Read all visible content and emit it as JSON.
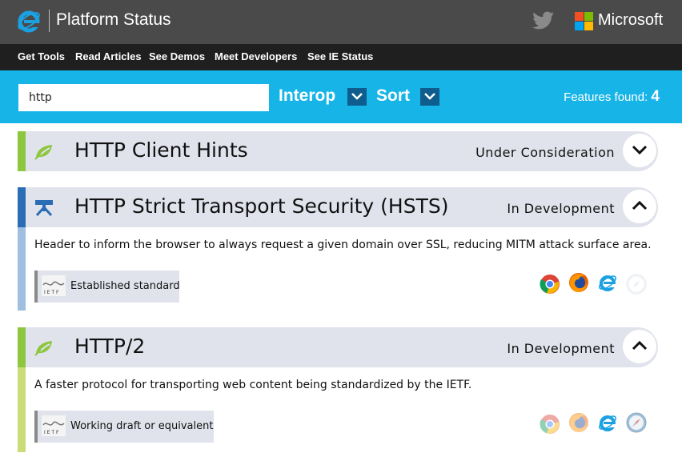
{
  "header": {
    "title": "Platform Status",
    "brand": "Microsoft",
    "colors": {
      "topbar": "#4a4a4a",
      "navbar": "#1f1f1f",
      "searchbar": "#17b4e8",
      "ie_blue": "#1ba1e2"
    }
  },
  "nav": {
    "items": [
      "Get Tools",
      "Read Articles",
      "See Demos",
      "Meet Developers",
      "See IE Status"
    ]
  },
  "search": {
    "value": "http",
    "filter1_label": "Interop",
    "filter2_label": "Sort",
    "features_found_label": "Features found:",
    "features_found_count": "4"
  },
  "features": [
    {
      "title": "HTTP Client Hints",
      "status": "Under Consideration",
      "expanded": false,
      "stripe_color": "#8dc63f",
      "icon": "leaf-icon"
    },
    {
      "title": "HTTP Strict Transport Security (HSTS)",
      "status": "In Development",
      "expanded": true,
      "stripe_color": "#2a6db5",
      "icon": "hammer-icon",
      "description": "Header to inform the browser to always request a given domain over SSL, reducing MITM attack surface area.",
      "standard": "Established standard",
      "browsers": [
        "chrome-icon",
        "firefox-icon",
        "ie-icon",
        "safari-icon"
      ]
    },
    {
      "title": "HTTP/2",
      "status": "In Development",
      "expanded": true,
      "stripe_color": "#8dc63f",
      "icon": "leaf-icon",
      "description": "A faster protocol for transporting web content being standardized by the IETF.",
      "standard": "Working draft or equivalent",
      "browsers": [
        "chrome-icon",
        "firefox-icon",
        "ie-icon",
        "safari-icon"
      ]
    }
  ]
}
